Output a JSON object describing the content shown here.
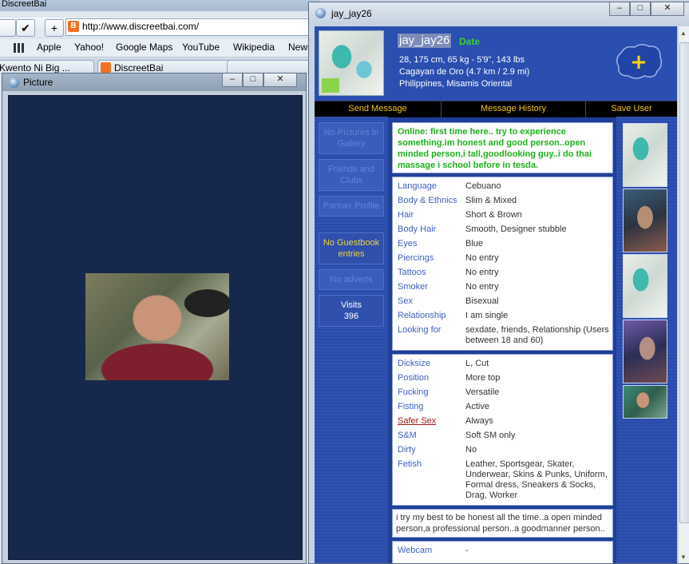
{
  "browser": {
    "title": "DiscreetBai",
    "url": "http://www.discreetbai.com/",
    "bookmarks": [
      "Apple",
      "Yahoo!",
      "Google Maps",
      "YouTube",
      "Wikipedia",
      "News"
    ],
    "tabs": [
      "Kwento Ni Big ...",
      "DiscreetBai"
    ]
  },
  "picture_window": {
    "title": "Picture"
  },
  "window_controls": {
    "minimize": "–",
    "maximize": "□",
    "close": "✕"
  },
  "profile": {
    "window_title": "jay_jay26",
    "username": "jay_jay26",
    "date_badge": "Date",
    "stats": "28, 175 cm, 65 kg - 5'9\", 143 lbs",
    "city": "Cagayan de Oro (4.7 km / 2.9 mi)",
    "region": "Philippines, Misamis Oriental",
    "add_symbol": "+",
    "actions": {
      "send_message": "Send Message",
      "history": "Message History",
      "save_user": "Save User"
    },
    "sidebar": {
      "no_pictures": "No Pictures in Gallery",
      "friends": "Friends and Clubs",
      "partner": "Partner Profile",
      "guestbook": "No Guestbook entries",
      "adverts": "No adverts",
      "visits_label": "Visits",
      "visits_count": "396"
    },
    "status_text": "Online: first time here.. try to experience something.im honest and good person..open minded person,i tall,goodlooking guy..i do thai massage i school before in tesda.",
    "details": [
      {
        "label": "Language",
        "value": "Cebuano"
      },
      {
        "label": "Body & Ethnics",
        "value": "Slim & Mixed"
      },
      {
        "label": "Hair",
        "value": "Short & Brown"
      },
      {
        "label": "Body Hair",
        "value": "Smooth, Designer stubble"
      },
      {
        "label": "Eyes",
        "value": "Blue"
      },
      {
        "label": "Piercings",
        "value": "No entry"
      },
      {
        "label": "Tattoos",
        "value": "No entry"
      },
      {
        "label": "Smoker",
        "value": "No entry"
      },
      {
        "label": "Sex",
        "value": "Bisexual"
      },
      {
        "label": "Relationship",
        "value": "I am single"
      },
      {
        "label": "Looking for",
        "value": "sexdate, friends, Relationship (Users between 18 and 60)"
      }
    ],
    "preferences": [
      {
        "label": "Dicksize",
        "value": "L, Cut"
      },
      {
        "label": "Position",
        "value": "More top"
      },
      {
        "label": "Fucking",
        "value": "Versatile"
      },
      {
        "label": "Fisting",
        "value": "Active"
      },
      {
        "label": "Safer Sex",
        "value": "Always"
      },
      {
        "label": "S&M",
        "value": "Soft SM only"
      },
      {
        "label": "Dirty",
        "value": "No"
      },
      {
        "label": "Fetish",
        "value": "Leather, Sportsgear, Skater, Underwear, Skins & Punks, Uniform, Formal dress, Sneakers & Socks, Drag, Worker"
      }
    ],
    "about": "i try my best to be honest all the time..a open minded person,a professional person..a goodmanner person..",
    "webcam": {
      "label": "Webcam",
      "value": "-"
    }
  },
  "colors": {
    "panel_blue": "#1f3f9a",
    "accent_yellow": "#f3c317",
    "status_green": "#1cb11c",
    "label_blue": "#3d5fc2"
  }
}
